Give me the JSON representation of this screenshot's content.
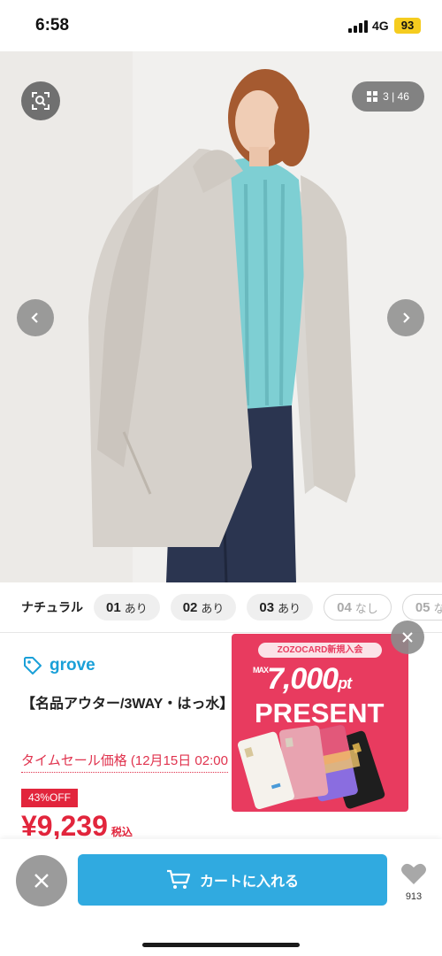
{
  "status_bar": {
    "time": "6:58",
    "network": "4G",
    "battery": "93"
  },
  "gallery": {
    "counter": "3 | 46",
    "icons": {
      "lens": "image-search-icon",
      "grid": "grid-icon",
      "prev": "chevron-left-icon",
      "next": "chevron-right-icon"
    }
  },
  "colors": {
    "selected_name": "ナチュラル",
    "chips": [
      {
        "num": "01",
        "status": "あり"
      },
      {
        "num": "02",
        "status": "あり"
      },
      {
        "num": "03",
        "status": "あり"
      },
      {
        "num": "04",
        "status": "なし"
      },
      {
        "num": "05",
        "status": "なし"
      }
    ]
  },
  "product": {
    "brand": "grove",
    "title": "【名品アウター/3WAY・はっ水】 コート",
    "sale_label": "タイムセール価格 (12月15日 02:00",
    "discount_badge": "43%OFF",
    "price": "¥9,239",
    "tax_label": "税込"
  },
  "promo": {
    "header": "ZOZOCARD新規入会",
    "max_label": "MAX",
    "amount": "7,000",
    "unit": "pt",
    "headline": "PRESENT"
  },
  "bottom_bar": {
    "cart_label": "カートに入れる",
    "fav_count": "913"
  },
  "theme": {
    "accent": "#30aae0",
    "sale_red": "#e2253c",
    "promo_pink": "#e83b5f"
  }
}
